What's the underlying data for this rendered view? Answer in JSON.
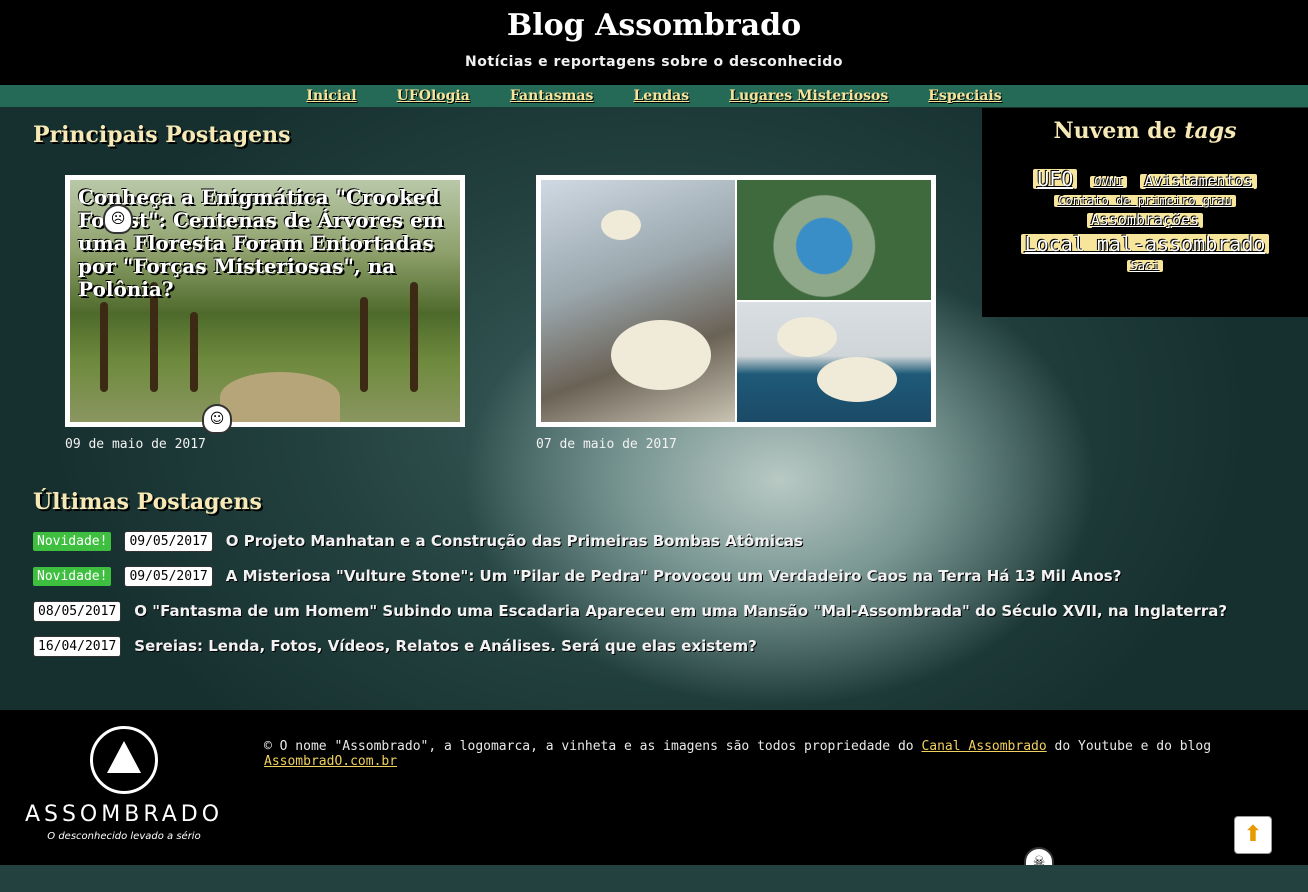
{
  "header": {
    "title": "Blog Assombrado",
    "subtitle": "Notícias e reportagens sobre o desconhecido"
  },
  "nav": {
    "items": [
      {
        "label": "Inicial"
      },
      {
        "label": "UFOlogia"
      },
      {
        "label": "Fantasmas"
      },
      {
        "label": "Lendas"
      },
      {
        "label": "Lugares Misteriosos"
      },
      {
        "label": "Especiais"
      }
    ]
  },
  "featured": {
    "heading": "Principais Postagens",
    "posts": [
      {
        "title": "Conheça a Enigmática \"Crooked Forest\": Centenas de Árvores em uma Floresta Foram Entortadas por \"Forças Misteriosas\", na Polônia?",
        "date": "09 de maio de 2017"
      },
      {
        "title": "",
        "date": "07 de maio de 2017"
      }
    ]
  },
  "tags": {
    "heading": "Nuvem de",
    "heading_em": "tags",
    "items": [
      {
        "label": "UFO"
      },
      {
        "label": "OVNI"
      },
      {
        "label": "Avistamentos"
      },
      {
        "label": "Contato de primeiro grau"
      },
      {
        "label": "Assombrações"
      },
      {
        "label": "Local mal-assombrado"
      },
      {
        "label": "Saci"
      }
    ]
  },
  "latest": {
    "heading": "Últimas Postagens",
    "new_label": "Novidade!",
    "posts": [
      {
        "is_new": true,
        "date": "09/05/2017",
        "title": "O Projeto Manhatan e a Construção das Primeiras Bombas Atômicas"
      },
      {
        "is_new": true,
        "date": "09/05/2017",
        "title": "A Misteriosa \"Vulture Stone\": Um \"Pilar de Pedra\" Provocou um Verdadeiro Caos na Terra Há 13 Mil Anos?"
      },
      {
        "is_new": false,
        "date": "08/05/2017",
        "title": "O \"Fantasma de um Homem\" Subindo uma Escadaria Apareceu em uma Mansão \"Mal-Assombrada\" do Século XVII, na Inglaterra?"
      },
      {
        "is_new": false,
        "date": "16/04/2017",
        "title": "Sereias: Lenda, Fotos, Vídeos, Relatos e Análises. Será que elas existem?"
      }
    ]
  },
  "footer": {
    "logo_word": "ASSOMBRADO",
    "logo_tagline": "O desconhecido levado a sério",
    "copy_before": "© O nome \"Assombrado\", a logomarca, a vinheta e as imagens são todos propriedade do ",
    "copy_link1": "Canal Assombrado",
    "copy_middle": " do Youtube e do blog ",
    "copy_link2": "AssombradO.com.br"
  },
  "colors": {
    "header_bg": "#000000",
    "nav_bg": "#256a57",
    "heading_gold": "#f7e9b5",
    "tag_bg": "#f6e59a",
    "new_badge": "#3fbf3f"
  }
}
